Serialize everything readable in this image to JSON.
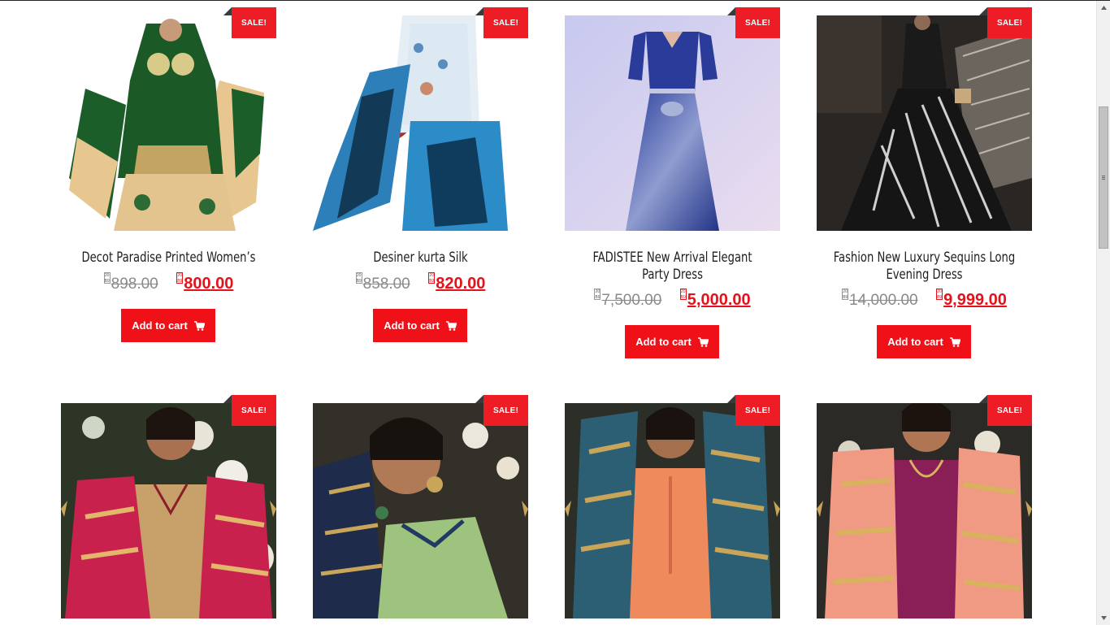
{
  "colors": {
    "accent": "#ee1c25",
    "sale_badge": "#ee1c25",
    "price_new": "#e3131c",
    "price_old": "#8a8a8a"
  },
  "currency_glyph": "20B9",
  "products": [
    {
      "sale_label": "SALE!",
      "title": "Decot Paradise Printed Women’s",
      "old_price": "898.00",
      "new_price": "800.00",
      "button_label": "Add to cart",
      "image": "green-printed-salwar-suit"
    },
    {
      "sale_label": "SALE!",
      "title": "Desiner kurta Silk",
      "old_price": "858.00",
      "new_price": "820.00",
      "button_label": "Add to cart",
      "image": "blue-white-printed-kurta"
    },
    {
      "sale_label": "SALE!",
      "title": "FADISTEE New Arrival Elegant Party Dress",
      "old_price": "7,500.00",
      "new_price": "5,000.00",
      "button_label": "Add to cart",
      "image": "blue-sequin-gown"
    },
    {
      "sale_label": "SALE!",
      "title": "Fashion New Luxury Sequins Long Evening Dress",
      "old_price": "14,000.00",
      "new_price": "9,999.00",
      "button_label": "Add to cart",
      "image": "black-silver-sequin-gown"
    },
    {
      "sale_label": "SALE!",
      "image": "pink-gold-banarasi-dupatta-suit"
    },
    {
      "sale_label": "SALE!",
      "image": "green-suit-navy-dupatta"
    },
    {
      "sale_label": "SALE!",
      "image": "orange-suit-teal-dupatta"
    },
    {
      "sale_label": "SALE!",
      "image": "magenta-suit-peach-dupatta"
    }
  ]
}
